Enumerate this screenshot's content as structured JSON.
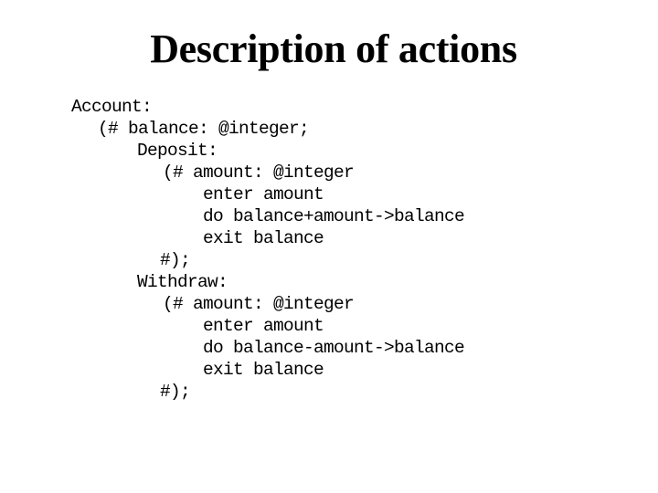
{
  "slide": {
    "title": "Description of actions",
    "code_lines": [
      {
        "text": "Account:",
        "indent": 0
      },
      {
        "text": "(# balance: @integer;",
        "indent": 1
      },
      {
        "text": "Deposit:",
        "indent": 2
      },
      {
        "text": "(# amount: @integer",
        "indent": 3
      },
      {
        "text": "enter amount",
        "indent": 4
      },
      {
        "text": "do balance+amount->balance",
        "indent": 4
      },
      {
        "text": "exit balance",
        "indent": 4
      },
      {
        "text": "#);",
        "indent": 3
      },
      {
        "text": "Withdraw:",
        "indent": 2
      },
      {
        "text": "(# amount: @integer",
        "indent": 3
      },
      {
        "text": "enter amount",
        "indent": 4
      },
      {
        "text": "do balance-amount->balance",
        "indent": 4
      },
      {
        "text": "exit balance",
        "indent": 4
      },
      {
        "text": "#);",
        "indent": 3
      }
    ]
  }
}
